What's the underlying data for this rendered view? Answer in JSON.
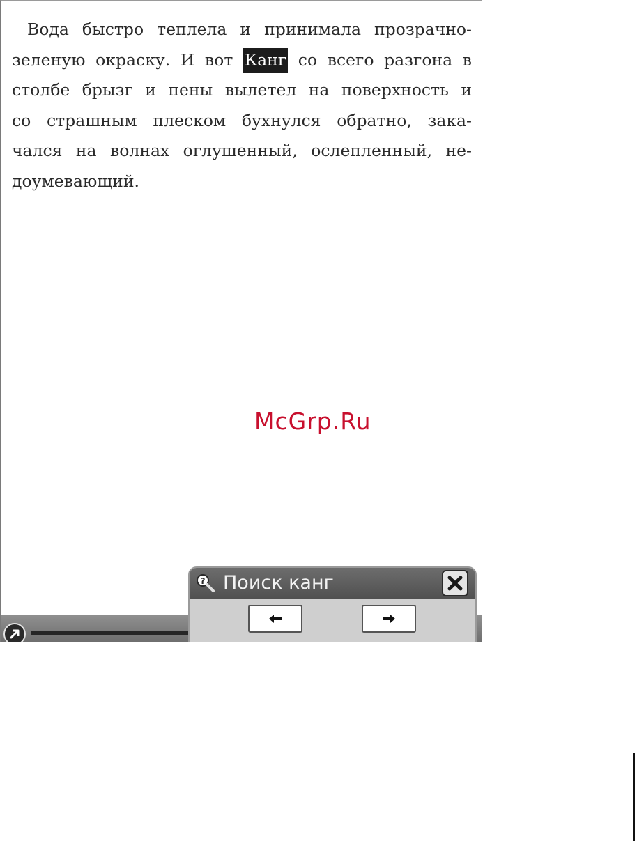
{
  "book": {
    "lines": [
      "Вода быстро теплела и принимала прозрачно-",
      "зеленую окраску. И вот",
      "Канг",
      "со всего разгона в",
      "столбе брызг и пены вылетел на поверхность и",
      "со страшным плеском бухнулся обратно, зака-",
      "чался на волнах оглушенный, ослепленный, не-",
      "доумевающий."
    ]
  },
  "watermark": {
    "text": "McGrp.Ru",
    "color": "#c8102e"
  },
  "search": {
    "title": "Поиск канг",
    "icon": "search-help-icon",
    "close_icon": "close-icon",
    "prev_icon": "arrow-left-icon",
    "next_icon": "arrow-right-icon"
  },
  "status_bar": {
    "nav_icon": "arrow-up-right-icon"
  }
}
